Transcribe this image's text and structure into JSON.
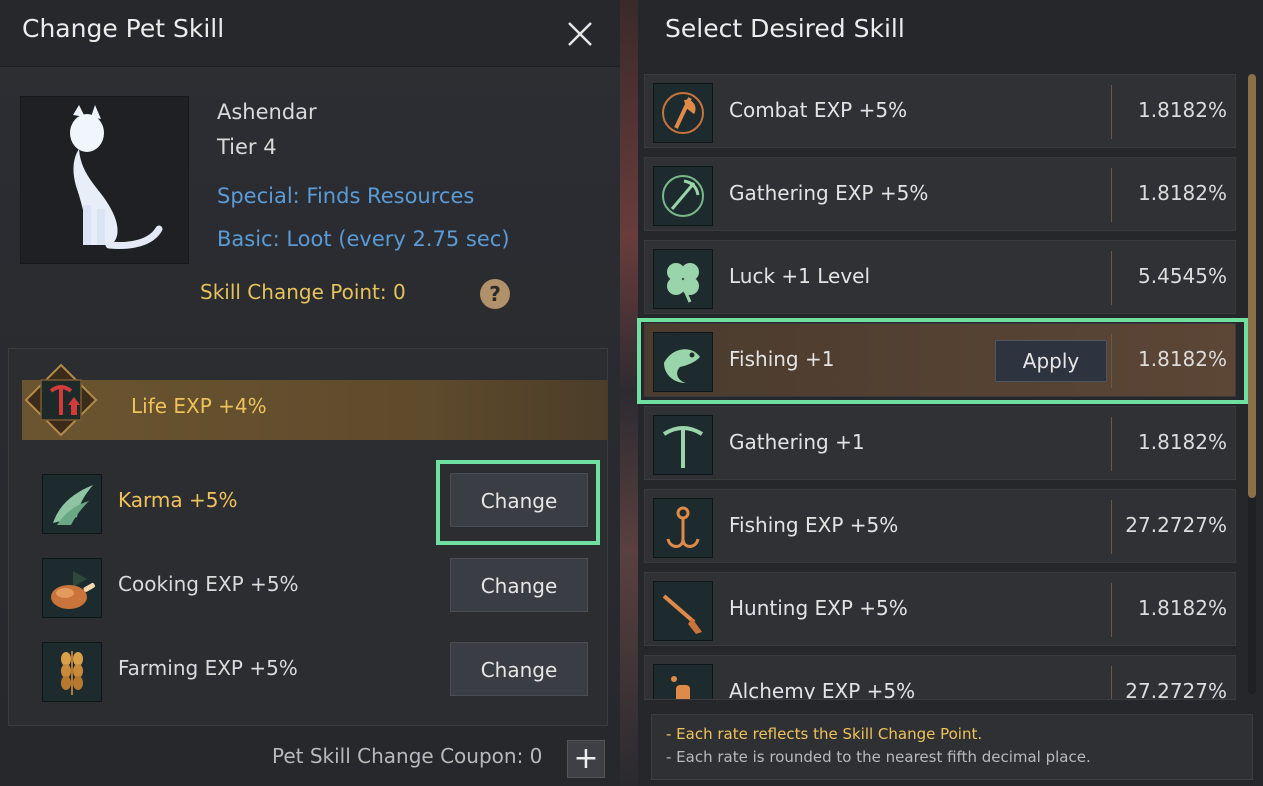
{
  "left": {
    "title": "Change Pet Skill",
    "pet": {
      "name": "Ashendar",
      "tier": "Tier 4",
      "special": "Special: Finds Resources",
      "basic": "Basic: Loot (every 2.75 sec)"
    },
    "skill_change_point": "Skill Change Point: 0",
    "help": "?",
    "life_skill": "Life EXP +4%",
    "skills": [
      {
        "label": "Karma +5%",
        "button": "Change"
      },
      {
        "label": "Cooking EXP +5%",
        "button": "Change"
      },
      {
        "label": "Farming EXP +5%",
        "button": "Change"
      }
    ],
    "coupon": "Pet Skill Change Coupon: 0",
    "plus": "+"
  },
  "right": {
    "title": "Select Desired Skill",
    "apply_label": "Apply",
    "options": [
      {
        "label": "Combat EXP +5%",
        "rate": "1.8182%",
        "icon": "axe-icon"
      },
      {
        "label": "Gathering EXP +5%",
        "rate": "1.8182%",
        "icon": "pickaxe-wreath-icon"
      },
      {
        "label": "Luck +1 Level",
        "rate": "5.4545%",
        "icon": "clover-icon"
      },
      {
        "label": "Fishing +1",
        "rate": "1.8182%",
        "icon": "fish-icon",
        "selected": true
      },
      {
        "label": "Gathering +1",
        "rate": "1.8182%",
        "icon": "pickaxe-icon"
      },
      {
        "label": "Fishing EXP +5%",
        "rate": "27.2727%",
        "icon": "hook-icon"
      },
      {
        "label": "Hunting EXP +5%",
        "rate": "1.8182%",
        "icon": "rifle-icon"
      },
      {
        "label": "Alchemy EXP +5%",
        "rate": "27.2727%",
        "icon": "flask-icon"
      }
    ],
    "notes": [
      "- Each rate reflects the Skill Change Point.",
      "- Each rate is rounded to the nearest fifth decimal place."
    ]
  },
  "colors": {
    "gold": "#f0c25a",
    "blue": "#5b9bd5",
    "highlight": "#6fe0a0"
  }
}
